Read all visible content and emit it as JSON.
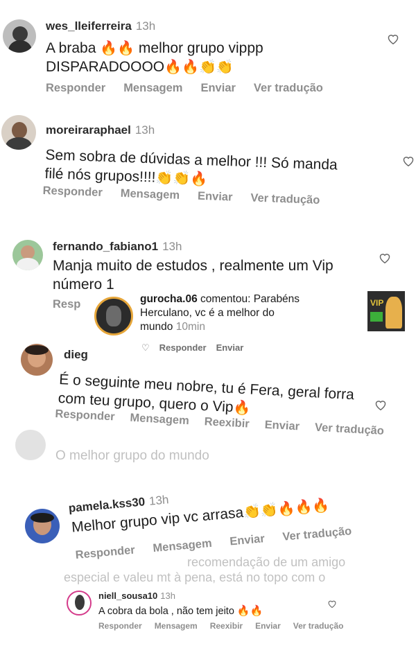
{
  "comments": [
    {
      "username": "wes_lleiferreira",
      "time": "13h",
      "text_line1": "A braba",
      "text_line1b": "melhor grupo vippp",
      "text_line2": "DISPARADOOOO",
      "actions": [
        "Responder",
        "Mensagem",
        "Enviar",
        "Ver tradução"
      ]
    },
    {
      "username": "moreiraraphael",
      "time": "13h",
      "text_line1": "Sem sobra de dúvidas a melhor !!! Só manda",
      "text_line2": "filé nós grupos!!!!",
      "actions": [
        "Responder",
        "Mensagem",
        "Enviar",
        "Ver tradução"
      ]
    },
    {
      "username": "fernando_fabiano1",
      "time": "13h",
      "text_line1": "Manja muito de estudos , realmente um Vip",
      "text_line2": "número 1",
      "actions": [
        "Resp"
      ]
    },
    {
      "username": "dieg",
      "text_line1": "É o seguinte meu nobre, tu é Fera, geral forra",
      "text_line2": "com teu grupo, quero o Vip",
      "actions": [
        "Responder",
        "Mensagem",
        "Reexibir",
        "Enviar",
        "Ver tradução"
      ]
    },
    {
      "faded_text": "O melhor grupo do mundo"
    },
    {
      "username": "pamela.kss30",
      "time": "13h",
      "text_line1": "Melhor grupo vip vc arrasa",
      "actions": [
        "Responder",
        "Mensagem",
        "Enviar",
        "Ver tradução"
      ]
    },
    {
      "faded_line1": "recomendação de um amigo",
      "faded_line2": "especial e valeu mt à pena, está no topo com o"
    },
    {
      "username": "niell_sousa10",
      "time": "13h",
      "text_line1": "A cobra da bola , não tem jeito",
      "actions": [
        "Responder",
        "Mensagem",
        "Reexibir",
        "Enviar",
        "Ver tradução"
      ]
    }
  ],
  "notification": {
    "username": "gurocha.06",
    "verb": "comentou: Parabéns",
    "line2": "Herculano, vc é a melhor do",
    "line3": "mundo",
    "time": "10min",
    "actions": [
      "Responder",
      "Enviar"
    ],
    "thumb_label": "VIP"
  },
  "colors": {
    "fire": "#ff5a12",
    "clap": "#f2c230",
    "muted": "#8e8e8e"
  }
}
